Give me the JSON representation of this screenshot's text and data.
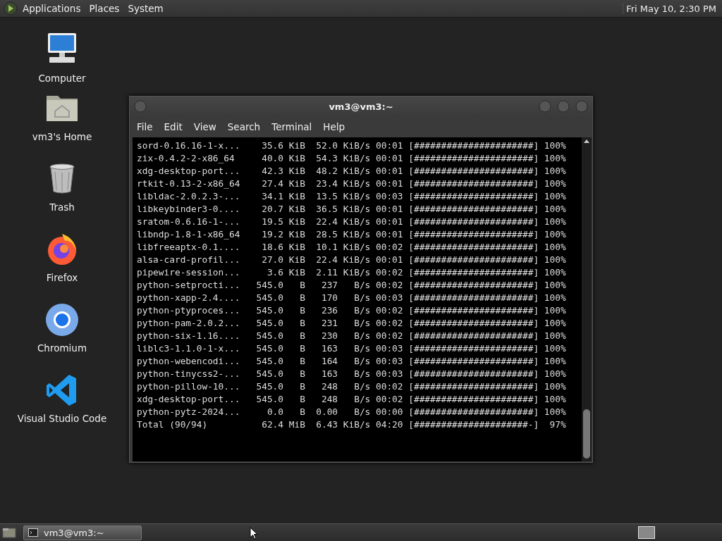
{
  "top_panel": {
    "menus": [
      "Applications",
      "Places",
      "System"
    ],
    "clock": "Fri May 10,  2:30 PM"
  },
  "desktop_icons": [
    {
      "label": "Computer",
      "kind": "computer"
    },
    {
      "label": "vm3's Home",
      "kind": "home"
    },
    {
      "label": "Trash",
      "kind": "trash"
    },
    {
      "label": "Firefox",
      "kind": "firefox"
    },
    {
      "label": "Chromium",
      "kind": "chromium"
    },
    {
      "label": "Visual Studio Code",
      "kind": "vscode"
    }
  ],
  "terminal_window": {
    "title": "vm3@vm3:~",
    "menu": [
      "File",
      "Edit",
      "View",
      "Search",
      "Terminal",
      "Help"
    ],
    "rows": [
      {
        "name": "sord-0.16.16-1-x...",
        "size": "35.6",
        "unit": "KiB",
        "rate": "52.0",
        "rate_unit": "KiB/s",
        "time": "00:01",
        "bar": "[######################]",
        "percent": "100%"
      },
      {
        "name": "zix-0.4.2-2-x86_64",
        "size": "40.0",
        "unit": "KiB",
        "rate": "54.3",
        "rate_unit": "KiB/s",
        "time": "00:01",
        "bar": "[######################]",
        "percent": "100%"
      },
      {
        "name": "xdg-desktop-port...",
        "size": "42.3",
        "unit": "KiB",
        "rate": "48.2",
        "rate_unit": "KiB/s",
        "time": "00:01",
        "bar": "[######################]",
        "percent": "100%"
      },
      {
        "name": "rtkit-0.13-2-x86_64",
        "size": "27.4",
        "unit": "KiB",
        "rate": "23.4",
        "rate_unit": "KiB/s",
        "time": "00:01",
        "bar": "[######################]",
        "percent": "100%"
      },
      {
        "name": "libldac-2.0.2.3-...",
        "size": "34.1",
        "unit": "KiB",
        "rate": "13.5",
        "rate_unit": "KiB/s",
        "time": "00:03",
        "bar": "[######################]",
        "percent": "100%"
      },
      {
        "name": "libkeybinder3-0....",
        "size": "20.7",
        "unit": "KiB",
        "rate": "36.5",
        "rate_unit": "KiB/s",
        "time": "00:01",
        "bar": "[######################]",
        "percent": "100%"
      },
      {
        "name": "sratom-0.6.16-1-...",
        "size": "19.5",
        "unit": "KiB",
        "rate": "22.4",
        "rate_unit": "KiB/s",
        "time": "00:01",
        "bar": "[######################]",
        "percent": "100%"
      },
      {
        "name": "libndp-1.8-1-x86_64",
        "size": "19.2",
        "unit": "KiB",
        "rate": "28.5",
        "rate_unit": "KiB/s",
        "time": "00:01",
        "bar": "[######################]",
        "percent": "100%"
      },
      {
        "name": "libfreeaptx-0.1....",
        "size": "18.6",
        "unit": "KiB",
        "rate": "10.1",
        "rate_unit": "KiB/s",
        "time": "00:02",
        "bar": "[######################]",
        "percent": "100%"
      },
      {
        "name": "alsa-card-profil...",
        "size": "27.0",
        "unit": "KiB",
        "rate": "22.4",
        "rate_unit": "KiB/s",
        "time": "00:01",
        "bar": "[######################]",
        "percent": "100%"
      },
      {
        "name": "pipewire-session...",
        "size": "3.6",
        "unit": "KiB",
        "rate": "2.11",
        "rate_unit": "KiB/s",
        "time": "00:02",
        "bar": "[######################]",
        "percent": "100%"
      },
      {
        "name": "python-setprocti...",
        "size": "545.0",
        "unit": "B",
        "rate": "237",
        "rate_unit": "B/s",
        "time": "00:02",
        "bar": "[######################]",
        "percent": "100%"
      },
      {
        "name": "python-xapp-2.4....",
        "size": "545.0",
        "unit": "B",
        "rate": "170",
        "rate_unit": "B/s",
        "time": "00:03",
        "bar": "[######################]",
        "percent": "100%"
      },
      {
        "name": "python-ptyproces...",
        "size": "545.0",
        "unit": "B",
        "rate": "236",
        "rate_unit": "B/s",
        "time": "00:02",
        "bar": "[######################]",
        "percent": "100%"
      },
      {
        "name": "python-pam-2.0.2...",
        "size": "545.0",
        "unit": "B",
        "rate": "231",
        "rate_unit": "B/s",
        "time": "00:02",
        "bar": "[######################]",
        "percent": "100%"
      },
      {
        "name": "python-six-1.16....",
        "size": "545.0",
        "unit": "B",
        "rate": "230",
        "rate_unit": "B/s",
        "time": "00:02",
        "bar": "[######################]",
        "percent": "100%"
      },
      {
        "name": "liblc3-1.1.0-1-x...",
        "size": "545.0",
        "unit": "B",
        "rate": "163",
        "rate_unit": "B/s",
        "time": "00:03",
        "bar": "[######################]",
        "percent": "100%"
      },
      {
        "name": "python-webencodi...",
        "size": "545.0",
        "unit": "B",
        "rate": "164",
        "rate_unit": "B/s",
        "time": "00:03",
        "bar": "[######################]",
        "percent": "100%"
      },
      {
        "name": "python-tinycss2-...",
        "size": "545.0",
        "unit": "B",
        "rate": "163",
        "rate_unit": "B/s",
        "time": "00:03",
        "bar": "[######################]",
        "percent": "100%"
      },
      {
        "name": "python-pillow-10...",
        "size": "545.0",
        "unit": "B",
        "rate": "248",
        "rate_unit": "B/s",
        "time": "00:02",
        "bar": "[######################]",
        "percent": "100%"
      },
      {
        "name": "xdg-desktop-port...",
        "size": "545.0",
        "unit": "B",
        "rate": "248",
        "rate_unit": "B/s",
        "time": "00:02",
        "bar": "[######################]",
        "percent": "100%"
      },
      {
        "name": "python-pytz-2024...",
        "size": "0.0",
        "unit": "B",
        "rate": "0.00",
        "rate_unit": "B/s",
        "time": "00:00",
        "bar": "[######################]",
        "percent": "100%"
      },
      {
        "name": "Total (90/94)",
        "size": "62.4",
        "unit": "MiB",
        "rate": "6.43",
        "rate_unit": "KiB/s",
        "time": "04:20",
        "bar": "[#####################-]",
        "percent": "97%"
      }
    ]
  },
  "taskbar": {
    "tasks": [
      {
        "label": "vm3@vm3:~",
        "selected": true
      }
    ]
  }
}
